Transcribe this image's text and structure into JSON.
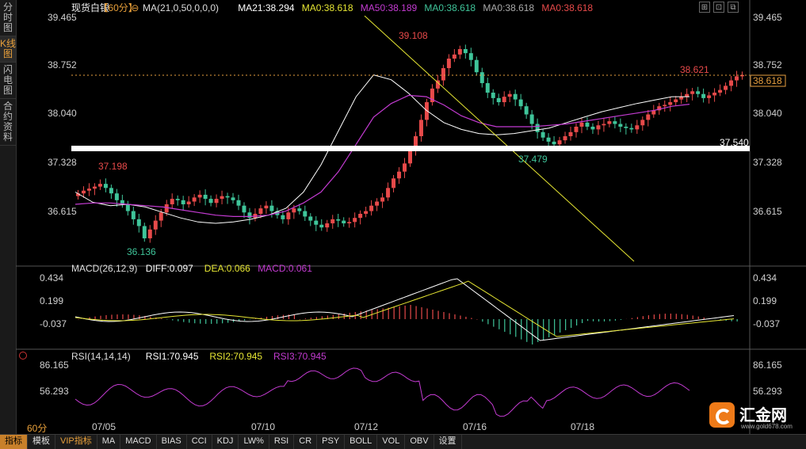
{
  "left_tabs": [
    "分时图",
    "K线图",
    "闪电图",
    "合约资料"
  ],
  "header": {
    "symbol": "现货白银",
    "period": "【60分】",
    "ma_label": "MA(21,0,50,0,0,0)",
    "ma21": "MA21:38.294",
    "ma0_1": "MA0:38.618",
    "ma50": "MA50:38.189",
    "ma0_2": "MA0:38.618",
    "ma0_3": "MA0:38.618",
    "ma0_4": "MA0:38.618"
  },
  "macd_header": {
    "label": "MACD(26,12,9)",
    "diff": "DIFF:0.097",
    "dea": "DEA:0.066",
    "macd": "MACD:0.061"
  },
  "rsi_header": {
    "label": "RSI(14,14,14)",
    "rsi1": "RSI1:70.945",
    "rsi2": "RSI2:70.945",
    "rsi3": "RSI3:70.945"
  },
  "bottom_tabs": [
    "指标",
    "模板",
    "VIP指标",
    "MA",
    "MACD",
    "BIAS",
    "CCI",
    "KDJ",
    "LW%",
    "RSI",
    "CR",
    "PSY",
    "BOLL",
    "VOL",
    "OBV",
    "设置"
  ],
  "period_label": "60分",
  "logo": {
    "text": "汇金网",
    "url": "www.gold678.com"
  },
  "colors": {
    "up": "#e84a4a",
    "down": "#3fc59a",
    "ma21": "#ffffff",
    "ma50": "#c43bd2",
    "trend": "#e6e633",
    "dea": "#e6e633",
    "rsi": "#c43bd2",
    "axis": "#d0d0d0",
    "grid": "#333333"
  },
  "chart_data": [
    {
      "type": "candlestick",
      "name": "price",
      "y_ticks": [
        39.465,
        38.752,
        38.04,
        37.328,
        36.615
      ],
      "ylim": [
        35.75,
        39.465
      ],
      "x_tick_labels": [
        "07/05",
        "07/10",
        "07/12",
        "07/16",
        "07/18"
      ],
      "annotations": {
        "high": "39.108",
        "low": "36.136",
        "swing_low": "37.479",
        "swing_high": "37.198",
        "last": "38.621",
        "last_box": "38.618",
        "support": "37.540"
      },
      "support_level": 37.54,
      "last_price": 38.618,
      "closes": [
        36.88,
        36.92,
        36.95,
        36.98,
        37.02,
        36.96,
        36.88,
        36.78,
        36.72,
        36.62,
        36.5,
        36.4,
        36.22,
        36.35,
        36.48,
        36.6,
        36.72,
        36.8,
        36.78,
        36.72,
        36.76,
        36.82,
        36.86,
        36.8,
        36.74,
        36.8,
        36.84,
        36.82,
        36.78,
        36.7,
        36.6,
        36.52,
        36.58,
        36.66,
        36.7,
        36.62,
        36.56,
        36.5,
        36.6,
        36.66,
        36.62,
        36.54,
        36.48,
        36.42,
        36.38,
        36.44,
        36.5,
        36.48,
        36.44,
        36.46,
        36.52,
        36.58,
        36.62,
        36.7,
        36.76,
        36.82,
        36.96,
        37.1,
        37.2,
        37.32,
        37.5,
        37.72,
        37.96,
        38.22,
        38.42,
        38.54,
        38.72,
        38.86,
        38.92,
        39.0,
        38.94,
        38.84,
        38.66,
        38.5,
        38.36,
        38.28,
        38.22,
        38.3,
        38.34,
        38.26,
        38.16,
        38.04,
        37.9,
        37.78,
        37.7,
        37.64,
        37.6,
        37.66,
        37.72,
        37.78,
        37.86,
        37.92,
        37.86,
        37.82,
        37.88,
        37.9,
        37.94,
        37.9,
        37.86,
        37.84,
        37.82,
        37.88,
        37.96,
        38.04,
        38.1,
        38.16,
        38.18,
        38.22,
        38.26,
        38.3,
        38.34,
        38.38,
        38.34,
        38.28,
        38.32,
        38.36,
        38.4,
        38.46,
        38.54,
        38.6,
        38.62
      ],
      "ma21_y": [
        36.9,
        36.75,
        36.7,
        36.72,
        36.68,
        36.6,
        36.52,
        36.46,
        36.44,
        36.46,
        36.5,
        36.56,
        36.66,
        36.9,
        37.3,
        37.8,
        38.3,
        38.62,
        38.55,
        38.35,
        38.1,
        37.92,
        37.82,
        37.76,
        37.74,
        37.76,
        37.8,
        37.84,
        37.92,
        38.0,
        38.08,
        38.14,
        38.2,
        38.25,
        38.3,
        38.3
      ],
      "ma50_y": [
        36.72,
        36.74,
        36.74,
        36.72,
        36.7,
        36.68,
        36.64,
        36.6,
        36.56,
        36.54,
        36.54,
        36.56,
        36.62,
        36.74,
        36.9,
        37.2,
        37.6,
        38.0,
        38.2,
        38.32,
        38.3,
        38.18,
        38.02,
        37.92,
        37.86,
        37.86,
        37.86,
        37.88,
        37.9,
        37.94,
        37.98,
        38.02,
        38.06,
        38.1,
        38.16,
        38.19
      ]
    },
    {
      "type": "bar",
      "name": "macd",
      "y_ticks": [
        0.434,
        0.199,
        -0.037
      ],
      "ylim": [
        -0.2,
        0.434
      ]
    },
    {
      "type": "line",
      "name": "rsi",
      "y_ticks": [
        86.165,
        56.293
      ],
      "ylim": [
        33,
        86.165
      ]
    }
  ]
}
